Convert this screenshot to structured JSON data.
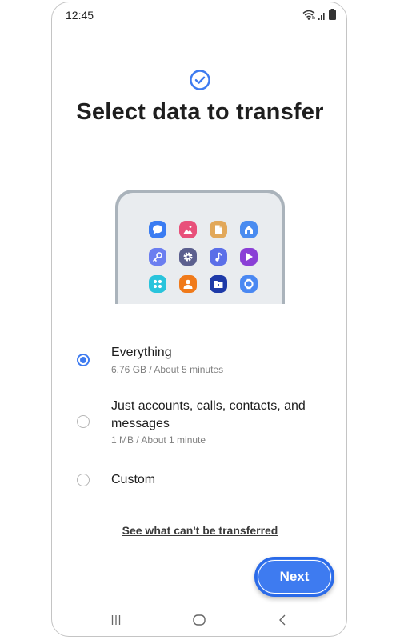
{
  "status_bar": {
    "time": "12:45",
    "icons": [
      "wifi-icon",
      "signal-icon",
      "battery-icon"
    ]
  },
  "header": {
    "icon": "check-circle-icon",
    "title": "Select data to transfer",
    "accent_color": "#3e7bf0"
  },
  "illustration": {
    "apps": [
      {
        "name": "messages-icon",
        "color": "#3a7cf2"
      },
      {
        "name": "gallery-icon",
        "color": "#e8507a"
      },
      {
        "name": "files-icon",
        "color": "#e2a85a"
      },
      {
        "name": "home-icon",
        "color": "#4a8cf0"
      },
      {
        "name": "key-icon",
        "color": "#6b7ef0"
      },
      {
        "name": "settings-icon",
        "color": "#5b5f8e"
      },
      {
        "name": "music-icon",
        "color": "#5b6fe8"
      },
      {
        "name": "video-icon",
        "color": "#8a3fd6"
      },
      {
        "name": "apps-icon",
        "color": "#29c4dc"
      },
      {
        "name": "contacts-icon",
        "color": "#f07a1a"
      },
      {
        "name": "secure-folder-icon",
        "color": "#1e3aa8"
      },
      {
        "name": "watch-icon",
        "color": "#4a88f2"
      }
    ]
  },
  "options": [
    {
      "label": "Everything",
      "sub": "6.76 GB / About 5 minutes",
      "selected": true
    },
    {
      "label": "Just accounts, calls, contacts, and messages",
      "sub": "1 MB / About 1 minute",
      "selected": false
    },
    {
      "label": "Custom",
      "sub": "",
      "selected": false
    }
  ],
  "link": {
    "label": "See what can't be transferred"
  },
  "next_button": {
    "label": "Next"
  },
  "nav_bar": {
    "items": [
      "recents-icon",
      "home-button-icon",
      "back-icon"
    ]
  }
}
